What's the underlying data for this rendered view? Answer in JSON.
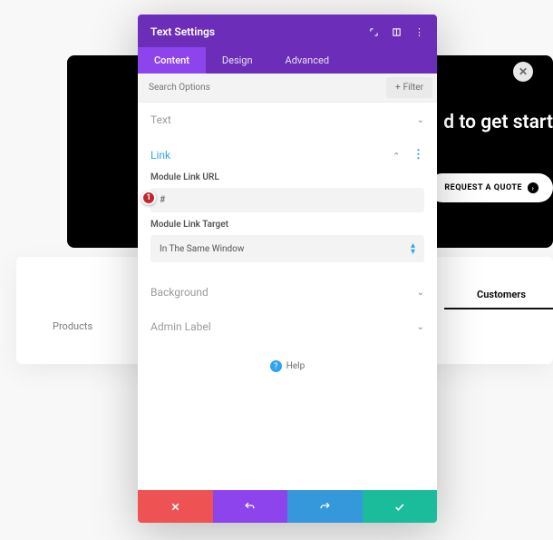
{
  "hero": {
    "title_fragment": "d to get start",
    "button_label": "REQUEST A QUOTE"
  },
  "bg_tabs": {
    "products": "Products",
    "customers": "Customers"
  },
  "modal": {
    "title": "Text Settings",
    "tabs": {
      "content": "Content",
      "design": "Design",
      "advanced": "Advanced"
    },
    "search_placeholder": "Search Options",
    "filter_label": "Filter",
    "sections": {
      "text": "Text",
      "link": "Link",
      "background": "Background",
      "admin_label": "Admin Label"
    },
    "link": {
      "url_label": "Module Link URL",
      "url_value": "#",
      "marker": "1",
      "target_label": "Module Link Target",
      "target_value": "In The Same Window"
    },
    "help_label": "Help"
  }
}
